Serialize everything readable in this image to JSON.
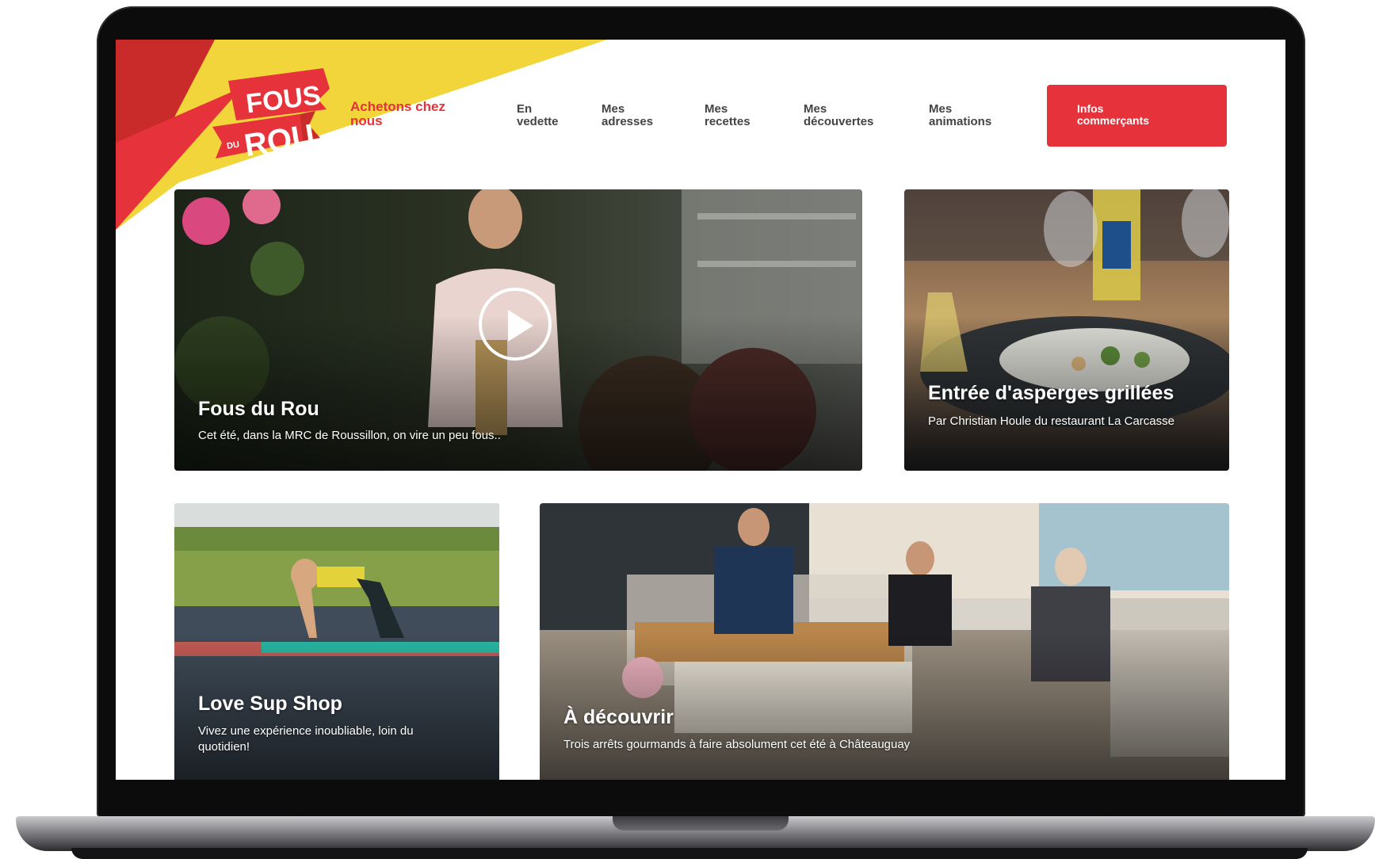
{
  "brand": {
    "logo_top": "FOUS",
    "logo_small": "DU",
    "logo_bottom": "ROU",
    "tagline": "Achetons chez nous",
    "colors": {
      "red": "#e5323b",
      "yellow": "#f2d43b",
      "dark_red": "#c92a2a"
    }
  },
  "nav": {
    "items": [
      {
        "label": "En\nvedette"
      },
      {
        "label": "Mes\nadresses"
      },
      {
        "label": "Mes\nrecettes"
      },
      {
        "label": "Mes\ndécouvertes"
      },
      {
        "label": "Mes\nanimations"
      }
    ],
    "cta": "Infos\ncommerçants"
  },
  "cards": {
    "feature": {
      "title": "Fous du Rou",
      "subtitle": "Cet été, dans la MRC de Roussillon, on vire un peu fous..",
      "play_icon": "play-icon"
    },
    "recipe": {
      "title": "Entrée d'asperges grillées",
      "subtitle": "Par Christian Houle du restaurant La Carcasse"
    },
    "sup": {
      "title": "Love Sup Shop",
      "subtitle": "Vivez une expérience inoubliable, loin du quotidien!"
    },
    "discover": {
      "title": "À découvrir",
      "subtitle": "Trois arrêts gourmands à faire absolument cet été à Châteauguay"
    }
  }
}
